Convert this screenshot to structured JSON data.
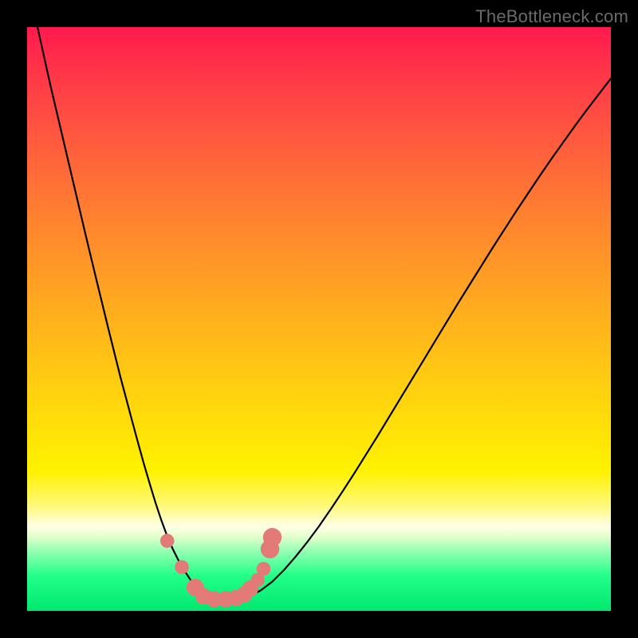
{
  "watermark": "TheBottleneck.com",
  "colors": {
    "frame_bg": "#000000",
    "curve_stroke": "#000000",
    "marker_fill": "#e27a78",
    "gradient_top": "#ff1a4d",
    "gradient_bottom": "#00e86e"
  },
  "chart_data": {
    "type": "line",
    "title": "",
    "xlabel": "",
    "ylabel": "",
    "xlim": [
      0,
      100
    ],
    "ylim": [
      0,
      100
    ],
    "grid": false,
    "x": [
      0,
      2,
      4,
      6,
      8,
      10,
      12,
      14,
      16,
      18,
      19,
      20,
      21,
      22,
      23,
      24,
      25,
      26,
      27,
      28,
      29,
      30,
      32,
      34,
      36,
      38,
      40,
      42,
      44,
      46,
      48,
      50,
      52,
      54,
      56,
      58,
      60,
      62,
      64,
      66,
      68,
      70,
      72,
      74,
      76,
      78,
      80,
      82,
      84,
      86,
      88,
      90,
      92,
      94,
      96,
      98,
      100
    ],
    "values": [
      108,
      99,
      90,
      81.5,
      73,
      64.5,
      56.2,
      48,
      40,
      32.5,
      28.8,
      25.2,
      21.8,
      18.5,
      15.5,
      12.8,
      10.5,
      8.5,
      6.8,
      5.3,
      4.1,
      3.2,
      2.2,
      2.0,
      2.0,
      2.5,
      3.5,
      5.0,
      7.0,
      9.3,
      11.8,
      14.5,
      17.4,
      20.4,
      23.5,
      26.7,
      29.9,
      33.2,
      36.5,
      39.8,
      43.1,
      46.4,
      49.7,
      53.0,
      56.2,
      59.4,
      62.6,
      65.7,
      68.8,
      71.8,
      74.8,
      77.7,
      80.5,
      83.3,
      86.0,
      88.6,
      91.2
    ],
    "markers": [
      {
        "x": 24.0,
        "y": 12.0,
        "r": 1.2
      },
      {
        "x": 26.5,
        "y": 7.5,
        "r": 1.2
      },
      {
        "x": 28.8,
        "y": 4.0,
        "r": 1.5
      },
      {
        "x": 30.2,
        "y": 2.5,
        "r": 1.4
      },
      {
        "x": 32.0,
        "y": 2.0,
        "r": 1.4
      },
      {
        "x": 34.0,
        "y": 2.0,
        "r": 1.4
      },
      {
        "x": 35.8,
        "y": 2.2,
        "r": 1.4
      },
      {
        "x": 37.2,
        "y": 2.8,
        "r": 1.4
      },
      {
        "x": 38.2,
        "y": 3.8,
        "r": 1.4
      },
      {
        "x": 39.5,
        "y": 5.3,
        "r": 1.2
      },
      {
        "x": 40.5,
        "y": 7.2,
        "r": 1.2
      },
      {
        "x": 41.6,
        "y": 10.6,
        "r": 1.6
      },
      {
        "x": 42.0,
        "y": 12.6,
        "r": 1.6
      }
    ],
    "annotations": []
  }
}
